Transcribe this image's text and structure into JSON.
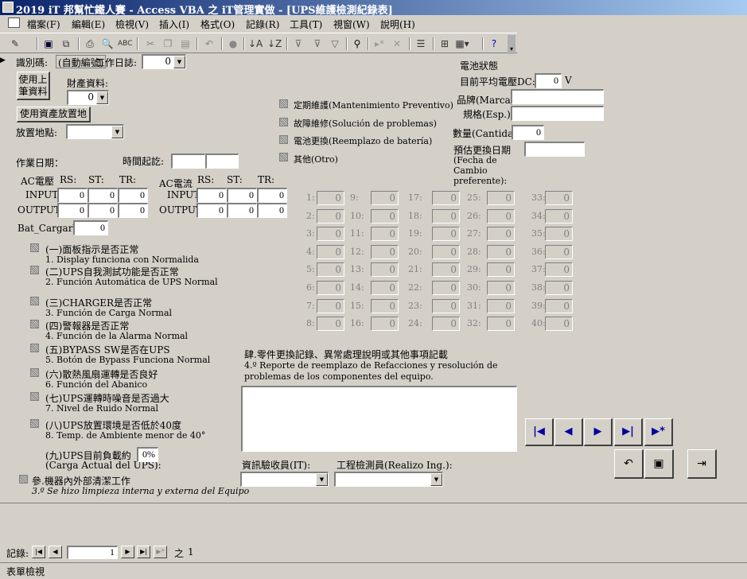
{
  "window": {
    "title": "2019 iT 邦幫忙鐵人賽 - Access VBA 之 iT管理實做 - [UPS維護檢測紀錄表]"
  },
  "menu": [
    "檔案(F)",
    "編輯(E)",
    "檢視(V)",
    "插入(I)",
    "格式(O)",
    "記錄(R)",
    "工具(T)",
    "視窗(W)",
    "說明(H)"
  ],
  "toolbar": {
    "icons": [
      "design-view-icon",
      "save-icon",
      "save-as-icon",
      "print-icon",
      "print-preview-icon",
      "spell-check-icon",
      "cut-icon",
      "copy-icon",
      "paste-icon",
      "undo-icon",
      "hyperlink-icon",
      "sort-asc-icon",
      "sort-desc-icon",
      "filter-by-selection-icon",
      "filter-by-form-icon",
      "apply-filter-icon",
      "find-icon",
      "new-record-icon",
      "delete-record-icon",
      "properties-icon",
      "database-window-icon",
      "new-object-icon",
      "help-icon"
    ]
  },
  "header": {
    "id_label": "識別碼:",
    "id_value": "(自動編號)",
    "workday_label": "工作日誌:",
    "workday_value": "0",
    "btn_load_last": "使用上筆資料",
    "asset_label": "財產資料:",
    "asset_value": "0",
    "btn_use_location": "使用資產放置地",
    "location_label": "放置地點:"
  },
  "work": {
    "date_label": "作業日期：",
    "time_label": "時間起訖:"
  },
  "voltage": {
    "ac_v_label": "AC電壓",
    "ac_a_label": "AC電流",
    "rs": "RS:",
    "st": "ST:",
    "tr": "TR:",
    "input": "INPUT",
    "output": "OUTPUT",
    "v_in": [
      "0",
      "0",
      "0"
    ],
    "v_out": [
      "0",
      "0",
      "0"
    ],
    "a_in": [
      "0",
      "0",
      "0"
    ],
    "a_out": [
      "0",
      "0",
      "0"
    ]
  },
  "bat_charge": {
    "label": "Bat_CargarV:",
    "value": "0"
  },
  "checks": [
    {
      "zh": "(一)面板指示是否正常",
      "es": "1. Display funciona con Normalida"
    },
    {
      "zh": "(二)UPS自我測試功能是否正常",
      "es": "2. Función Automática de UPS Normal"
    },
    {
      "zh": "(三)CHARGER是否正常",
      "es": "3. Función de Carga Normal"
    },
    {
      "zh": "(四)警報器是否正常",
      "es": "4. Función de la Alarma Normal"
    },
    {
      "zh": "(五)BYPASS SW是否在UPS",
      "es": "5. Botón de Bypass Funciona Normal"
    },
    {
      "zh": "(六)散熱風扇運轉是否良好",
      "es": "6. Función del Abanico"
    },
    {
      "zh": "(七)UPS運轉時噪音是否過大",
      "es": "7.  Nivel de Ruido Normal"
    },
    {
      "zh": "(八)UPS放置環境是否低於40度",
      "es": "8. Temp. de Ambiente menor de 40°"
    }
  ],
  "load": {
    "zh": "(九)UPS目前負載約",
    "es": "(Carga Actual del UPS):",
    "value": "0%"
  },
  "clean": {
    "zh": "參.機器內外部清潔工作",
    "es": "3.º Se hizo limpieza interna y externa del Equipo"
  },
  "maint": [
    {
      "label": "定期維護(Mantenimiento Preventivo)"
    },
    {
      "label": "故障維修(Solución de problemas)"
    },
    {
      "label": "電池更換(Reemplazo de batería)"
    },
    {
      "label": "其他(Otro)"
    }
  ],
  "battery": {
    "title": "電池狀態",
    "avg_label": "目前平均電壓DC:",
    "avg_value": "0",
    "unit": "V",
    "brand_label": "品牌(Marca):",
    "spec_label": "規格(Esp.):",
    "qty_label": "數量(Cantidad",
    "qty_value": "0",
    "replace_label": "預估更換日期",
    "replace_sub": "(Fecha de Cambio preferente):"
  },
  "cells": {
    "value": "0",
    "labels": [
      "1:",
      "2:",
      "3:",
      "4:",
      "5:",
      "6:",
      "7:",
      "8:",
      "9:",
      "10:",
      "11:",
      "12:",
      "13:",
      "14:",
      "15:",
      "16:",
      "17:",
      "18:",
      "19:",
      "20:",
      "21:",
      "22:",
      "23:",
      "24:",
      "25:",
      "26:",
      "27:",
      "28:",
      "29:",
      "30:",
      "31:",
      "32:",
      "33:",
      "34:",
      "35:",
      "36:",
      "37:",
      "38:",
      "39:",
      "40:"
    ]
  },
  "notes": {
    "zh": "肆.零件更換記錄、異常處理說明或其他事項記載",
    "es1": "4.º Reporte de reemplazo de Refacciones y resolución de",
    "es2": "problemas de los componentes del equipo."
  },
  "signers": {
    "it_label": "資訊驗收員(IT):",
    "eng_label": "工程檢測員(Realizo Ing.):"
  },
  "nav": [
    "first-record-icon",
    "prev-record-icon",
    "next-record-icon",
    "last-record-icon",
    "new-record-nav-icon"
  ],
  "actions": [
    "undo-action-icon",
    "save-record-icon",
    "exit-form-icon"
  ],
  "recordnav": {
    "label": "記錄:",
    "current": "1",
    "of": "之",
    "total": "1"
  },
  "status": {
    "text": "表單檢視"
  }
}
